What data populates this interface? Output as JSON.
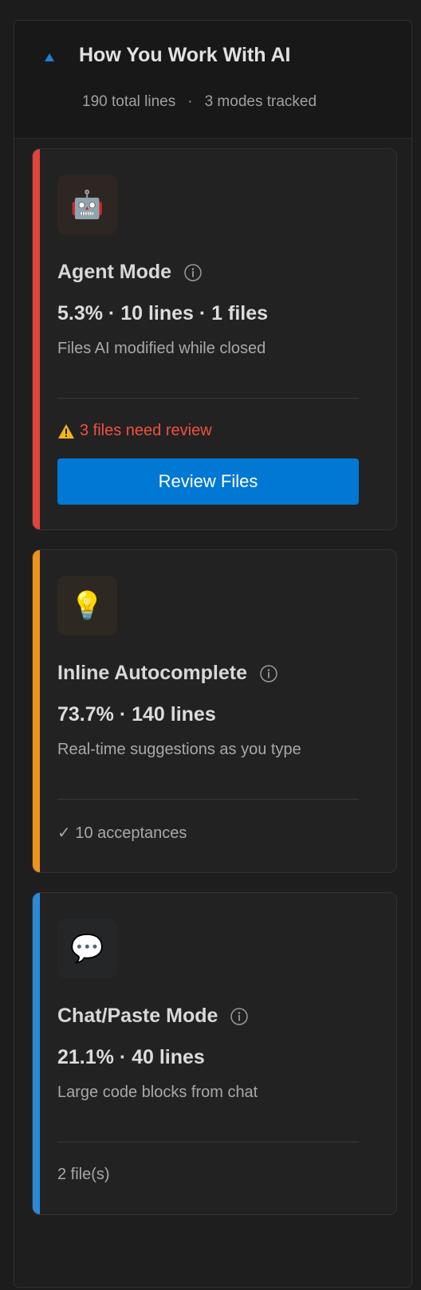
{
  "header": {
    "title": "How You Work With AI",
    "total_lines": "190 total lines",
    "separator": "·",
    "modes_tracked": "3 modes tracked",
    "toggle_icon": "caret-up-icon",
    "accent_color": "#1e7fd6"
  },
  "cards": [
    {
      "id": "agent",
      "icon": "robot-icon",
      "icon_glyph": "🤖",
      "accent_color": "#e0443a",
      "title": "Agent Mode",
      "stats": "5.3% · 10 lines · 1 files",
      "description": "Files AI modified while closed",
      "warning": "3 files need review",
      "warning_color": "#f0503f",
      "button_label": "Review Files",
      "button_color": "#0078d4"
    },
    {
      "id": "autocomplete",
      "icon": "lightbulb-icon",
      "icon_glyph": "💡",
      "accent_color": "#f0921e",
      "title": "Inline Autocomplete",
      "stats": "73.7% · 140 lines",
      "description": "Real-time suggestions as you type",
      "footer": "✓ 10 acceptances"
    },
    {
      "id": "chat",
      "icon": "speech-bubble-icon",
      "icon_glyph": "💬",
      "accent_color": "#2a8ad8",
      "title": "Chat/Paste Mode",
      "stats": "21.1% · 40 lines",
      "description": "Large code blocks from chat",
      "footer": "2 file(s)"
    }
  ]
}
